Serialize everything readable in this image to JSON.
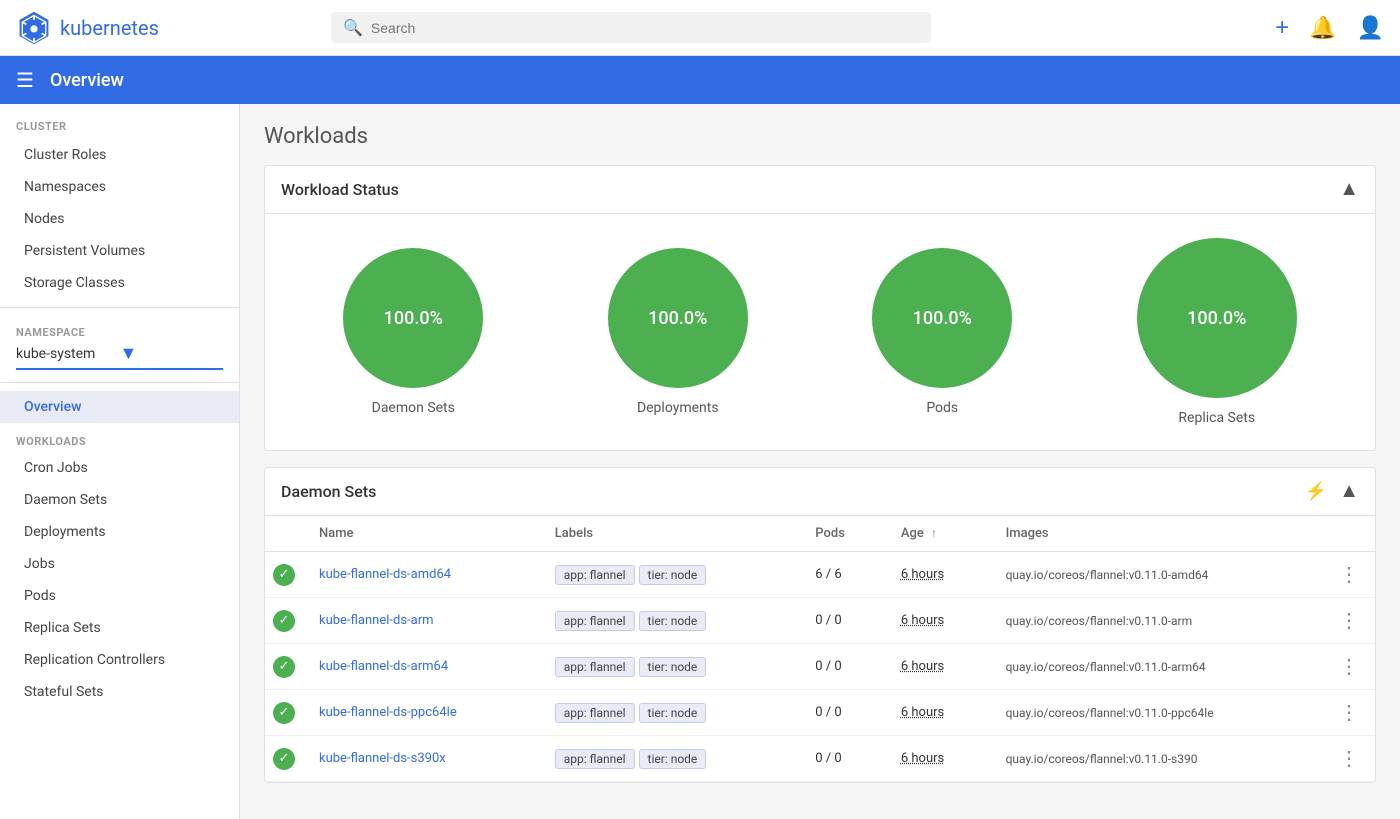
{
  "topnav": {
    "logo_text": "kubernetes",
    "search_placeholder": "Search",
    "add_label": "+",
    "notification_label": "🔔",
    "account_label": "👤"
  },
  "subheader": {
    "menu_label": "☰",
    "title": "Overview"
  },
  "sidebar": {
    "cluster_label": "Cluster",
    "items_cluster": [
      {
        "id": "cluster-roles",
        "label": "Cluster Roles"
      },
      {
        "id": "namespaces",
        "label": "Namespaces"
      },
      {
        "id": "nodes",
        "label": "Nodes"
      },
      {
        "id": "persistent-volumes",
        "label": "Persistent Volumes"
      },
      {
        "id": "storage-classes",
        "label": "Storage Classes"
      }
    ],
    "namespace_label": "Namespace",
    "namespace_value": "kube-system",
    "nav_overview": "Overview",
    "workloads_label": "Workloads",
    "items_workloads": [
      {
        "id": "cron-jobs",
        "label": "Cron Jobs"
      },
      {
        "id": "daemon-sets",
        "label": "Daemon Sets"
      },
      {
        "id": "deployments",
        "label": "Deployments"
      },
      {
        "id": "jobs",
        "label": "Jobs"
      },
      {
        "id": "pods",
        "label": "Pods"
      },
      {
        "id": "replica-sets",
        "label": "Replica Sets"
      },
      {
        "id": "replication-controllers",
        "label": "Replication Controllers"
      },
      {
        "id": "stateful-sets",
        "label": "Stateful Sets"
      }
    ]
  },
  "main": {
    "page_title": "Workloads",
    "workload_status": {
      "title": "Workload Status",
      "items": [
        {
          "id": "daemon-sets",
          "label": "Daemon Sets",
          "value": "100.0%"
        },
        {
          "id": "deployments",
          "label": "Deployments",
          "value": "100.0%"
        },
        {
          "id": "pods",
          "label": "Pods",
          "value": "100.0%"
        },
        {
          "id": "replica-sets",
          "label": "Replica Sets",
          "value": "100.0%"
        }
      ]
    },
    "daemon_sets": {
      "title": "Daemon Sets",
      "columns": [
        "Name",
        "Labels",
        "Pods",
        "Age",
        "Images"
      ],
      "rows": [
        {
          "name": "kube-flannel-ds-amd64",
          "labels": [
            "app: flannel",
            "tier: node"
          ],
          "pods": "6 / 6",
          "age": "6 hours",
          "images": "quay.io/coreos/flannel:v0.11.0-amd64"
        },
        {
          "name": "kube-flannel-ds-arm",
          "labels": [
            "app: flannel",
            "tier: node"
          ],
          "pods": "0 / 0",
          "age": "6 hours",
          "images": "quay.io/coreos/flannel:v0.11.0-arm"
        },
        {
          "name": "kube-flannel-ds-arm64",
          "labels": [
            "app: flannel",
            "tier: node"
          ],
          "pods": "0 / 0",
          "age": "6 hours",
          "images": "quay.io/coreos/flannel:v0.11.0-arm64"
        },
        {
          "name": "kube-flannel-ds-ppc64le",
          "labels": [
            "app: flannel",
            "tier: node"
          ],
          "pods": "0 / 0",
          "age": "6 hours",
          "images": "quay.io/coreos/flannel:v0.11.0-ppc64le"
        },
        {
          "name": "kube-flannel-ds-s390x",
          "labels": [
            "app: flannel",
            "tier: node"
          ],
          "pods": "0 / 0",
          "age": "6 hours",
          "images": "quay.io/coreos/flannel:v0.11.0-s390"
        }
      ]
    }
  }
}
